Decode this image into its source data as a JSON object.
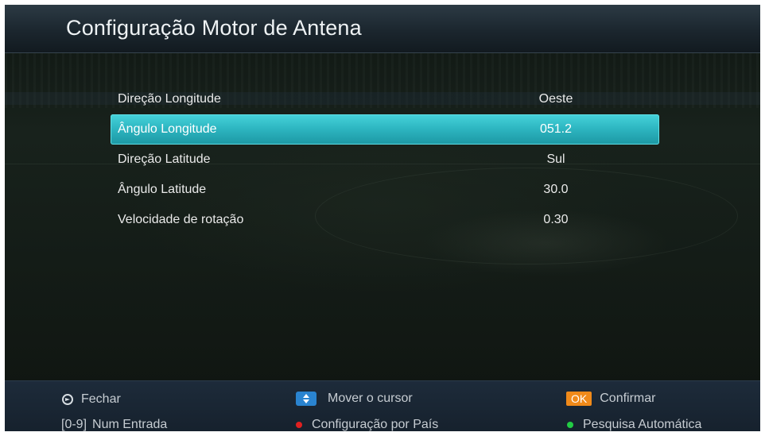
{
  "header": {
    "title": "Configuração Motor de Antena"
  },
  "menu": {
    "items": [
      {
        "label": "Direção Longitude",
        "value": "Oeste",
        "selected": false
      },
      {
        "label": "Ângulo Longitude",
        "value": "051.2",
        "selected": true
      },
      {
        "label": "Direção Latitude",
        "value": "Sul",
        "selected": false
      },
      {
        "label": "Ângulo Latitude",
        "value": "30.0",
        "selected": false
      },
      {
        "label": "Velocidade de rotação",
        "value": "0.30",
        "selected": false
      }
    ]
  },
  "footer": {
    "close": {
      "icon": "exit-icon",
      "label": "Fechar"
    },
    "move": {
      "icon": "up-down-icon",
      "label": "Mover o cursor"
    },
    "confirm": {
      "key": "OK",
      "label": "Confirmar"
    },
    "num_entry": {
      "key": "[0-9]",
      "label": "Num Entrada"
    },
    "country_config": {
      "icon": "red-dot-icon",
      "label": "Configuração por País"
    },
    "auto_search": {
      "icon": "green-dot-icon",
      "label": "Pesquisa Automática"
    }
  },
  "colors": {
    "highlight": "#2eb7c2",
    "ok_key": "#f08a1a",
    "nav_key": "#2a84d0",
    "red_key": "#e02020",
    "green_key": "#22cc44"
  }
}
